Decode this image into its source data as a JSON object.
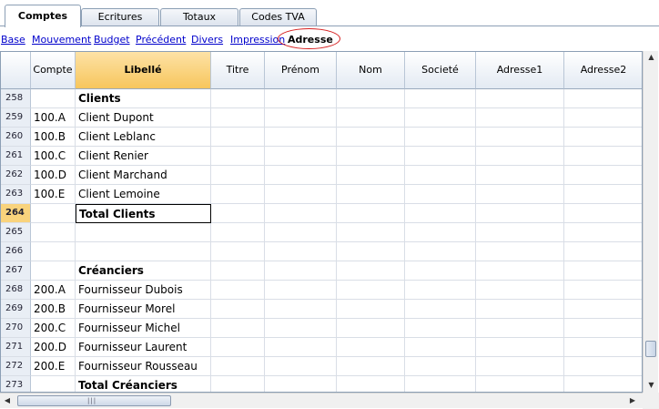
{
  "tabs": [
    "Comptes",
    "Ecritures",
    "Totaux",
    "Codes TVA"
  ],
  "active_tab": "Comptes",
  "views": [
    "Base",
    "Mouvement",
    "Budget",
    "Précédent",
    "Divers",
    "Impression",
    "Adresse"
  ],
  "active_view": "Adresse",
  "columns": [
    "",
    "Compte",
    "Libellé",
    "Titre",
    "Prénom",
    "Nom",
    "Societé",
    "Adresse1",
    "Adresse2"
  ],
  "rows": [
    {
      "n": "258",
      "compte": "",
      "libelle": "Clients"
    },
    {
      "n": "259",
      "compte": "100.A",
      "libelle": "Client Dupont"
    },
    {
      "n": "260",
      "compte": "100.B",
      "libelle": "Client Leblanc"
    },
    {
      "n": "261",
      "compte": "100.C",
      "libelle": "Client Renier"
    },
    {
      "n": "262",
      "compte": "100.D",
      "libelle": "Client Marchand"
    },
    {
      "n": "263",
      "compte": "100.E",
      "libelle": "Client Lemoine"
    },
    {
      "n": "264",
      "compte": "",
      "libelle": "Total Clients"
    },
    {
      "n": "265",
      "compte": "",
      "libelle": ""
    },
    {
      "n": "266",
      "compte": "",
      "libelle": ""
    },
    {
      "n": "267",
      "compte": "",
      "libelle": "Créanciers"
    },
    {
      "n": "268",
      "compte": "200.A",
      "libelle": "Fournisseur Dubois"
    },
    {
      "n": "269",
      "compte": "200.B",
      "libelle": "Fournisseur Morel"
    },
    {
      "n": "270",
      "compte": "200.C",
      "libelle": "Fournisseur Michel"
    },
    {
      "n": "271",
      "compte": "200.D",
      "libelle": "Fournisseur Laurent"
    },
    {
      "n": "272",
      "compte": "200.E",
      "libelle": "Fournisseur Rousseau"
    },
    {
      "n": "273",
      "compte": "",
      "libelle": "Total Créanciers"
    }
  ],
  "selected_row": "264",
  "colors": {
    "accent_header": "#f7c65c",
    "header_bg": "#e3eaf3",
    "link": "#0000cc",
    "highlight_circle": "#d62020"
  },
  "icons": [
    "arrow-left-icon",
    "arrow-right-icon",
    "arrow-up-icon",
    "arrow-down-icon",
    "grip-icon"
  ]
}
